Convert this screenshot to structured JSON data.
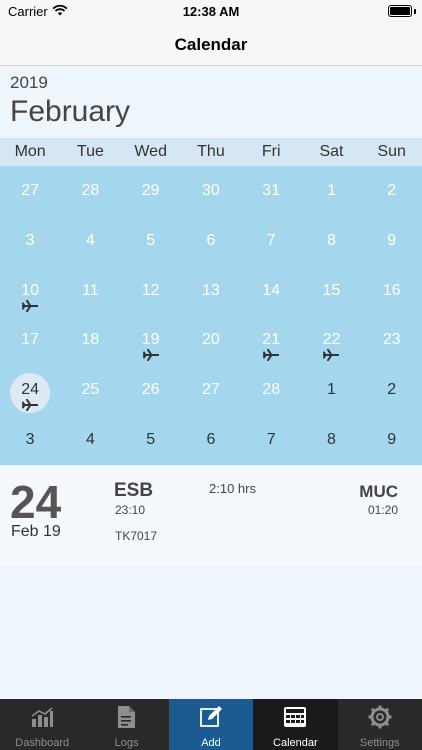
{
  "status_bar": {
    "carrier": "Carrier",
    "time": "12:38 AM"
  },
  "nav": {
    "title": "Calendar"
  },
  "calendar": {
    "year": "2019",
    "month": "February",
    "weekdays": [
      "Mon",
      "Tue",
      "Wed",
      "Thu",
      "Fri",
      "Sat",
      "Sun"
    ],
    "weeks": [
      [
        {
          "d": "27",
          "type": "other"
        },
        {
          "d": "28",
          "type": "other"
        },
        {
          "d": "29",
          "type": "other"
        },
        {
          "d": "30",
          "type": "other"
        },
        {
          "d": "31",
          "type": "other"
        },
        {
          "d": "1",
          "type": "future"
        },
        {
          "d": "2",
          "type": "future"
        }
      ],
      [
        {
          "d": "3",
          "type": "future"
        },
        {
          "d": "4",
          "type": "future"
        },
        {
          "d": "5",
          "type": "future"
        },
        {
          "d": "6",
          "type": "future"
        },
        {
          "d": "7",
          "type": "future"
        },
        {
          "d": "8",
          "type": "future"
        },
        {
          "d": "9",
          "type": "future"
        }
      ],
      [
        {
          "d": "10",
          "type": "future",
          "flight": true
        },
        {
          "d": "11",
          "type": "future"
        },
        {
          "d": "12",
          "type": "future"
        },
        {
          "d": "13",
          "type": "future"
        },
        {
          "d": "14",
          "type": "future"
        },
        {
          "d": "15",
          "type": "future"
        },
        {
          "d": "16",
          "type": "future"
        }
      ],
      [
        {
          "d": "17",
          "type": "future"
        },
        {
          "d": "18",
          "type": "future"
        },
        {
          "d": "19",
          "type": "future",
          "flight": true
        },
        {
          "d": "20",
          "type": "future"
        },
        {
          "d": "21",
          "type": "future",
          "flight": true
        },
        {
          "d": "22",
          "type": "future",
          "flight": true
        },
        {
          "d": "23",
          "type": "future"
        }
      ],
      [
        {
          "d": "24",
          "type": "current",
          "selected": true,
          "flight": true
        },
        {
          "d": "25",
          "type": "future"
        },
        {
          "d": "26",
          "type": "future"
        },
        {
          "d": "27",
          "type": "future"
        },
        {
          "d": "28",
          "type": "future"
        },
        {
          "d": "1",
          "type": "nextmonth"
        },
        {
          "d": "2",
          "type": "nextmonth"
        }
      ],
      [
        {
          "d": "3",
          "type": "nextmonth"
        },
        {
          "d": "4",
          "type": "nextmonth"
        },
        {
          "d": "5",
          "type": "nextmonth"
        },
        {
          "d": "6",
          "type": "nextmonth"
        },
        {
          "d": "7",
          "type": "nextmonth"
        },
        {
          "d": "8",
          "type": "nextmonth"
        },
        {
          "d": "9",
          "type": "nextmonth"
        }
      ]
    ]
  },
  "detail": {
    "day": "24",
    "date": "Feb  19",
    "from_code": "ESB",
    "from_time": "23:10",
    "duration": "2:10 hrs",
    "to_code": "MUC",
    "to_time": "01:20",
    "flight_no": "TK7017"
  },
  "tabs": [
    {
      "label": "Dashboard",
      "icon": "bar-chart-icon"
    },
    {
      "label": "Logs",
      "icon": "document-icon"
    },
    {
      "label": "Add",
      "icon": "edit-icon"
    },
    {
      "label": "Calendar",
      "icon": "calculator-icon"
    },
    {
      "label": "Settings",
      "icon": "gear-icon"
    }
  ],
  "colors": {
    "grid": "#a4d6ee",
    "header": "#d6e6f3",
    "active_tab": "#1a5c92"
  }
}
